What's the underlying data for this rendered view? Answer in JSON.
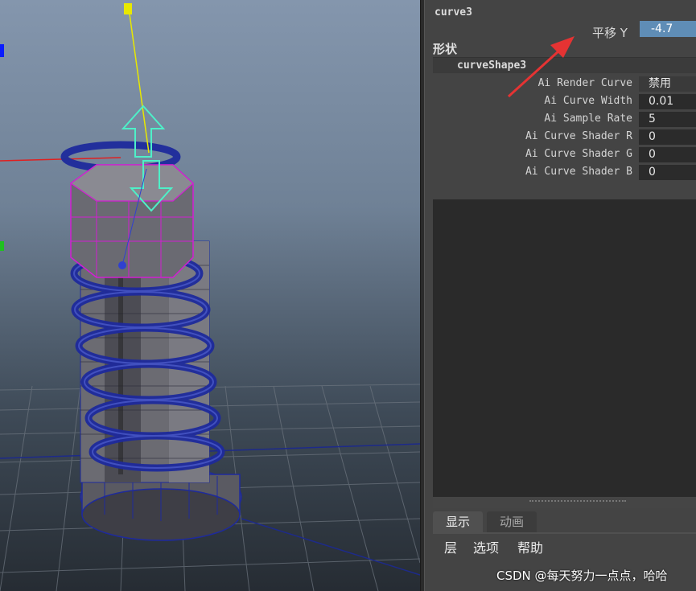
{
  "attribute_editor": {
    "node_name": "curve3",
    "translate_y": {
      "label": "平移 Y",
      "value": "-4.7"
    },
    "shape_section_title": "形状",
    "shape_node_name": "curveShape3",
    "attributes": [
      {
        "label": "Ai Render Curve",
        "value": "禁用"
      },
      {
        "label": "Ai Curve Width",
        "value": "0.01"
      },
      {
        "label": "Ai Sample Rate",
        "value": "5"
      },
      {
        "label": "Ai Curve Shader R",
        "value": "0"
      },
      {
        "label": "Ai Curve Shader G",
        "value": "0"
      },
      {
        "label": "Ai Curve Shader B",
        "value": "0"
      }
    ]
  },
  "layer_editor": {
    "tabs": [
      "显示",
      "动画"
    ],
    "active_tab": "显示",
    "menu": [
      "层",
      "选项",
      "帮助"
    ]
  },
  "watermark": "CSDN @每天努力一点点，哈哈",
  "colors": {
    "highlight_field": "#5f8db6",
    "annotation_arrow": "#e53333",
    "wireframe_blue": "#1e2a9c",
    "selection_magenta": "#d21ed2",
    "manipulator_cyan": "#4ef0c8",
    "manipulator_yellow": "#e8e800"
  },
  "icons": [
    "red-annotation-arrow-icon",
    "move-manipulator-icon"
  ]
}
